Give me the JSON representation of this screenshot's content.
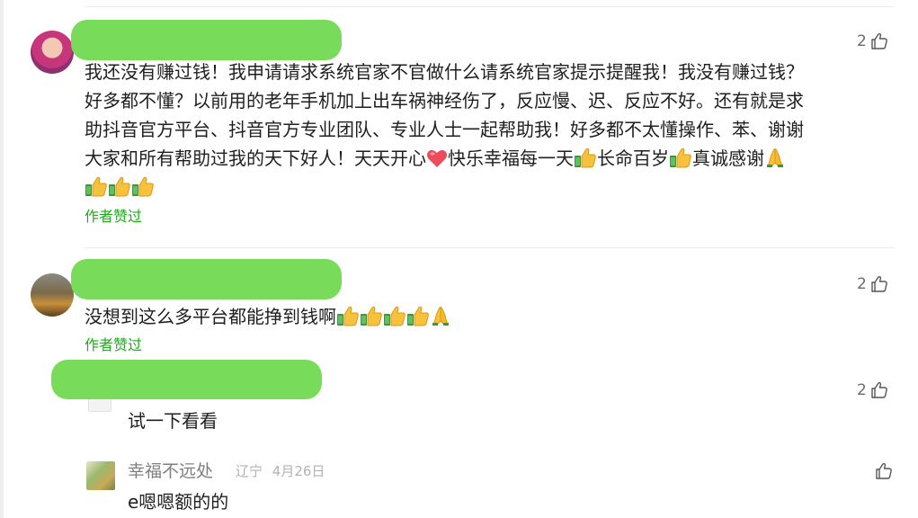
{
  "comments": [
    {
      "likes": "2",
      "text_lines": [
        "我还没有赚过钱！我申请请求系统官家不官做什么请系统官家提示提醒我！我没有赚过钱？",
        "好多都不懂？以前用的老年手机加上出车祸神经伤了，反应慢、迟、反应不好。还有就是求",
        "助抖音官方平台、抖音官方专业团队、专业人士一起帮助我！好多都不太懂操作、苯、谢谢",
        "大家和所有帮助过我的天下好人！天天开心",
        "快乐幸福每一天",
        "长命百岁",
        "真诚感谢"
      ],
      "author_liked": "作者赞过"
    },
    {
      "likes": "2",
      "text": "没想到这么多平台都能挣到钱啊",
      "author_liked": "作者赞过"
    },
    {
      "likes": "2",
      "text": "试一下看看"
    },
    {
      "username": "幸福不远处",
      "location": "辽宁",
      "date": "4月26日",
      "text": "e嗯嗯额的的"
    }
  ],
  "icons": [
    "thumbs-up-outline-icon",
    "heart-emoji-icon",
    "thumbs-up-emoji-icon",
    "praying-hands-emoji-icon"
  ]
}
